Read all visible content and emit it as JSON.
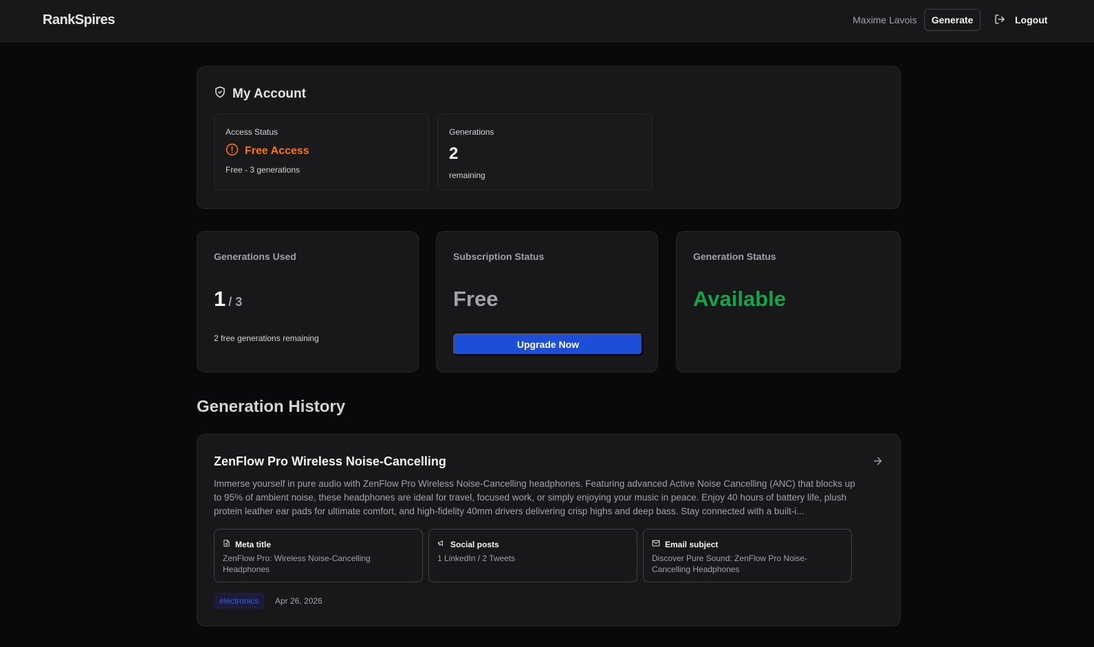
{
  "header": {
    "brand": "RankSpires",
    "user_name": "Maxime Lavois",
    "generate_label": "Generate",
    "logout_label": "Logout"
  },
  "account": {
    "title": "My Account",
    "access_status": {
      "label": "Access Status",
      "value": "Free Access",
      "sub": "Free - 3 generations"
    },
    "generations": {
      "label": "Generations",
      "value": "2",
      "sub": "remaining"
    }
  },
  "stats": {
    "used": {
      "label": "Generations Used",
      "value": "1",
      "total": "/ 3",
      "sub": "2 free generations remaining"
    },
    "subscription": {
      "label": "Subscription Status",
      "value": "Free",
      "button": "Upgrade Now"
    },
    "generation_status": {
      "label": "Generation Status",
      "value": "Available"
    }
  },
  "history": {
    "title": "Generation History",
    "items": [
      {
        "title": "ZenFlow Pro Wireless Noise-Cancelling",
        "description": "Immerse yourself in pure audio with ZenFlow Pro Wireless Noise-Cancelling headphones. Featuring advanced Active Noise Cancelling (ANC) that blocks up to 95% of ambient noise, these headphones are ideal for travel, focused work, or simply enjoying your music in peace. Enjoy 40 hours of battery life, plush protein leather ear pads for ultimate comfort, and high-fidelity 40mm drivers delivering crisp highs and deep bass. Stay connected with a built-i...",
        "meta": {
          "label": "Meta title",
          "value": "ZenFlow Pro: Wireless Noise-Cancelling Headphones"
        },
        "social": {
          "label": "Social posts",
          "value": "1 LinkedIn / 2 Tweets"
        },
        "email": {
          "label": "Email subject",
          "value": "Discover Pure Sound: ZenFlow Pro Noise-Cancelling Headphones"
        },
        "tag": "electronics",
        "date": "Apr 26, 2026"
      }
    ]
  },
  "colors": {
    "background": "#09090b",
    "card": "#18181b",
    "accent_orange": "#f97316",
    "accent_green": "#16a34a",
    "accent_blue": "#1d4ed8"
  },
  "icons": {
    "account": "shield-check-icon",
    "access": "alert-circle-icon",
    "logout": "logout-icon",
    "open": "arrow-right-icon",
    "meta": "document-icon",
    "social": "megaphone-icon",
    "email": "mail-icon"
  }
}
